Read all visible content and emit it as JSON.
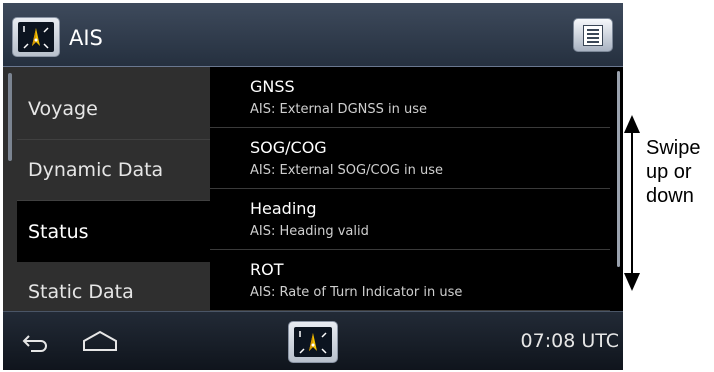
{
  "header": {
    "title": "AIS",
    "app_icon": "radar-compass-icon",
    "menu_icon": "menu-list-icon"
  },
  "sidebar": {
    "items": [
      {
        "label": "Voyage",
        "active": false
      },
      {
        "label": "Dynamic Data",
        "active": false
      },
      {
        "label": "Status",
        "active": true
      },
      {
        "label": "Static Data",
        "active": false
      }
    ]
  },
  "main": {
    "rows": [
      {
        "title": "GNSS",
        "subtitle": "AIS: External DGNSS in use"
      },
      {
        "title": "SOG/COG",
        "subtitle": "AIS: External SOG/COG in use"
      },
      {
        "title": "Heading",
        "subtitle": "AIS: Heading valid"
      },
      {
        "title": "ROT",
        "subtitle": "AIS: Rate of Turn Indicator in use"
      }
    ]
  },
  "bottom": {
    "clock": "07:08 UTC",
    "back_icon": "back-arrow-icon",
    "home_icon": "home-icon"
  },
  "annotation": {
    "line1": "Swipe",
    "line2": "up or",
    "line3": "down"
  },
  "colors": {
    "background": "#000000",
    "header": "#2f3a4a",
    "sidebar": "#2f2f2f"
  }
}
